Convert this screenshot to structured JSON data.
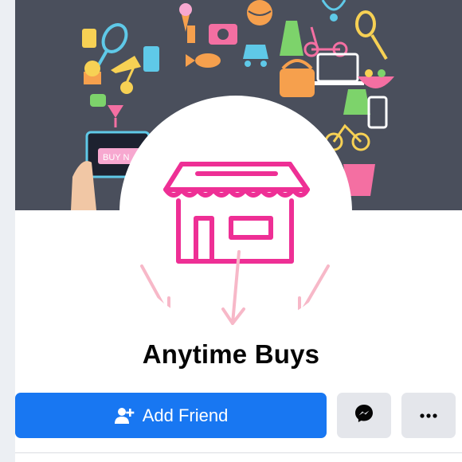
{
  "cover": {
    "sign_text": "BUY N"
  },
  "profile": {
    "name": "Anytime Buys"
  },
  "actions": {
    "add_friend_label": "Add Friend",
    "messenger_icon": "messenger-icon",
    "more_icon": "more-horizontal-icon",
    "add_friend_icon": "add-person-icon"
  },
  "colors": {
    "primary": "#1877f2",
    "secondary_button": "#e4e6eb",
    "store_logo": "#ee2f95",
    "arrows": "#f7b8c8",
    "cover_background": "#4a4f5c"
  }
}
